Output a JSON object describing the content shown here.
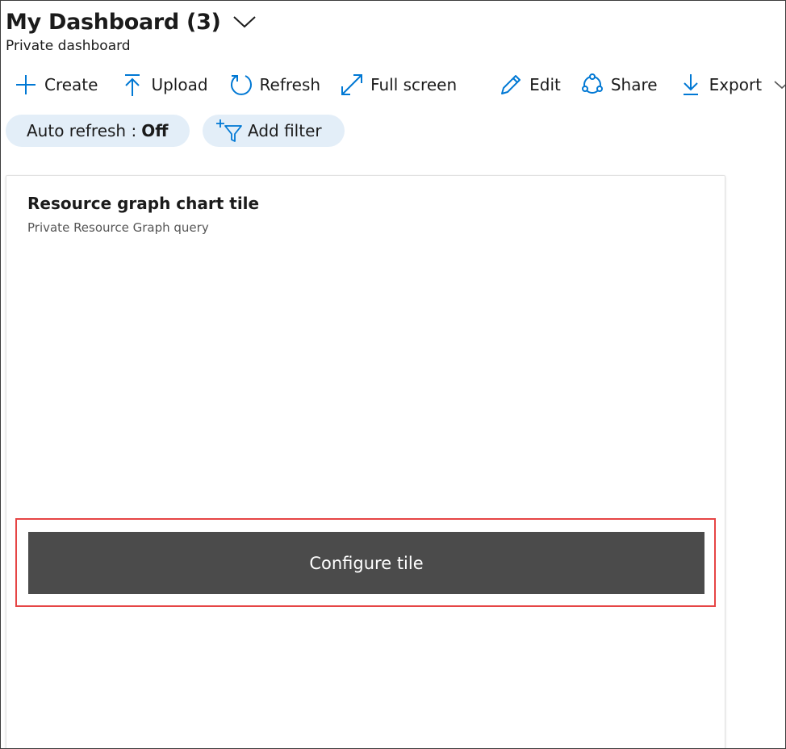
{
  "header": {
    "title": "My Dashboard (3)",
    "subtitle": "Private dashboard"
  },
  "toolbar": {
    "items": [
      {
        "label": "Create",
        "icon": "plus-icon"
      },
      {
        "label": "Upload",
        "icon": "upload-icon"
      },
      {
        "label": "Refresh",
        "icon": "refresh-icon"
      },
      {
        "label": "Full screen",
        "icon": "fullscreen-icon"
      },
      {
        "label": "Edit",
        "icon": "pencil-icon"
      },
      {
        "label": "Share",
        "icon": "share-icon"
      },
      {
        "label": "Export",
        "icon": "download-icon"
      }
    ]
  },
  "filters": {
    "auto_refresh_label": "Auto refresh :",
    "auto_refresh_value": "Off",
    "add_filter_label": "Add filter"
  },
  "tile": {
    "title": "Resource graph chart tile",
    "subtitle": "Private Resource Graph query",
    "configure_label": "Configure tile"
  },
  "colors": {
    "accent": "#0078d4",
    "pill_bg": "#e3eef8",
    "button_bg": "#4b4b4b",
    "highlight": "#e64545"
  }
}
